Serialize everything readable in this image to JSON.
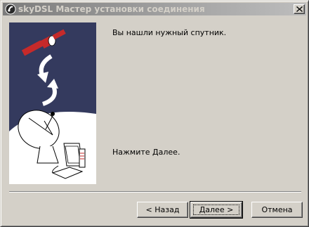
{
  "window": {
    "title": "skyDSL Мастер установки соединения"
  },
  "content": {
    "message": "Вы нашли нужный спутник.",
    "hint": "Нажмите Далее."
  },
  "buttons": {
    "back": "< Назад",
    "next": "Далее >",
    "cancel": "Отмена"
  },
  "icons": {
    "app": "skydsl-logo-icon",
    "close": "close-icon"
  },
  "colors": {
    "illustration_background": "#343a5e",
    "illustration_accent": "#d42a2a",
    "face": "#d4d0c8"
  }
}
